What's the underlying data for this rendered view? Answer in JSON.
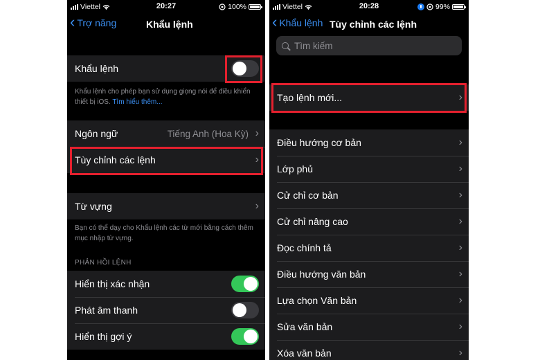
{
  "left_phone": {
    "status": {
      "carrier": "Viettel",
      "time": "20:27",
      "battery": "100%",
      "battery_level": 1.0
    },
    "nav": {
      "back_label": "Trợ năng",
      "title": "Khẩu lệnh"
    },
    "voice_control": {
      "label": "Khẩu lệnh",
      "enabled": false,
      "footnote": "Khẩu lệnh cho phép bạn sử dụng giọng nói để điều khiển thiết bị iOS.",
      "learn_more": "Tìm hiểu thêm..."
    },
    "language": {
      "label": "Ngôn ngữ",
      "value": "Tiếng Anh (Hoa Kỳ)"
    },
    "customize": {
      "label": "Tùy chỉnh các lệnh"
    },
    "vocabulary": {
      "label": "Từ vựng",
      "footnote": "Bạn có thể dạy cho Khẩu lệnh các từ mới bằng cách thêm mục nhập từ vựng."
    },
    "feedback": {
      "header": "PHẢN HỒI LỆNH",
      "items": [
        {
          "label": "Hiển thị xác nhận",
          "enabled": true
        },
        {
          "label": "Phát âm thanh",
          "enabled": false
        },
        {
          "label": "Hiển thị gợi ý",
          "enabled": true
        }
      ]
    }
  },
  "right_phone": {
    "status": {
      "carrier": "Viettel",
      "time": "20:28",
      "battery": "99%",
      "battery_level": 0.99
    },
    "nav": {
      "back_label": "Khẩu lệnh",
      "title": "Tùy chỉnh các lệnh"
    },
    "search": {
      "placeholder": "Tìm kiếm"
    },
    "create_new": {
      "label": "Tạo lệnh mới..."
    },
    "categories": [
      "Điều hướng cơ bản",
      "Lớp phủ",
      "Cử chỉ cơ bản",
      "Cử chỉ nâng cao",
      "Đọc chính tả",
      "Điều hướng văn bản",
      "Lựa chọn Văn bản",
      "Sửa văn bản",
      "Xóa văn bản"
    ]
  },
  "colors": {
    "highlight": "#e4202e",
    "accent": "#3b8ef0",
    "toggle_on": "#34c759",
    "group_bg": "#1c1c1e"
  }
}
